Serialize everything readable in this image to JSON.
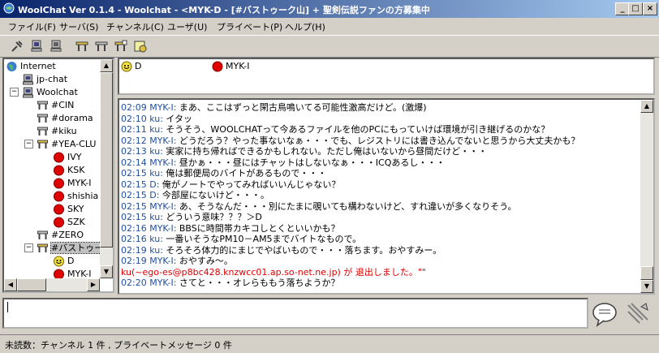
{
  "window": {
    "title": "WoolChat Ver 0.1.4 - Woolchat - <MYK-D - [#バストゥーク山] + 聖剣伝説ファンの方募集中",
    "controls": [
      "_",
      "□",
      "×"
    ]
  },
  "menu": [
    "ファイル(F)",
    "サーバ(S)",
    "チャンネル(C)",
    "ユーザ(U)",
    "プライベート(P)",
    "ヘルプ(H)"
  ],
  "tree": {
    "items": [
      {
        "label": "Internet",
        "icon": "globe-icon"
      },
      {
        "label": "jp-chat",
        "icon": "computer-icon"
      },
      {
        "label": "Woolchat",
        "icon": "computer-icon"
      },
      {
        "label": "#CIN",
        "icon": "channel-table-icon"
      },
      {
        "label": "#dorama",
        "icon": "channel-table-icon"
      },
      {
        "label": "#kiku",
        "icon": "channel-table-icon"
      },
      {
        "label": "#YEA-CLU",
        "icon": "channel-table-joined-icon"
      },
      {
        "label": "IVY",
        "icon": "user-red-icon"
      },
      {
        "label": "KSK",
        "icon": "user-red-icon"
      },
      {
        "label": "MYK-I",
        "icon": "user-red-icon"
      },
      {
        "label": "shishia",
        "icon": "user-red-icon"
      },
      {
        "label": "SKY",
        "icon": "user-red-icon"
      },
      {
        "label": "SZK",
        "icon": "user-red-icon"
      },
      {
        "label": "#ZERO",
        "icon": "channel-table-icon"
      },
      {
        "label": "#バストゥーク",
        "icon": "channel-table-joined-icon"
      },
      {
        "label": "D",
        "icon": "user-smile-icon"
      },
      {
        "label": "MYK-I",
        "icon": "user-red-icon"
      }
    ]
  },
  "users": [
    {
      "name": "D",
      "icon": "user-smile-icon"
    },
    {
      "name": "MYK-I",
      "icon": "user-red-icon"
    }
  ],
  "log": [
    {
      "time": "02:09",
      "nick": "MYK-I",
      "text": "まあ、ここはずっと閑古鳥鳴いてる可能性激高だけど。(激爆)"
    },
    {
      "time": "02:10",
      "nick": "ku",
      "text": "イタッ"
    },
    {
      "time": "02:11",
      "nick": "ku",
      "text": "そうそう、WOOLCHATって今あるファイルを他のPCにもっていけば環境が引き継げるのかな？"
    },
    {
      "time": "02:12",
      "nick": "MYK-I",
      "text": "どうだろう？やった事ないなぁ・・・でも、レジストリには書き込んでないと思うから大丈夫かも？"
    },
    {
      "time": "02:13",
      "nick": "ku",
      "text": "実家に持ち帰ればできるかもしれない。ただし俺はいないから昼間だけど・・・"
    },
    {
      "time": "02:14",
      "nick": "MYK-I",
      "text": "昼かぁ・・・昼にはチャットはしないなぁ・・・ICQあるし・・・"
    },
    {
      "time": "02:15",
      "nick": "ku",
      "text": "俺は郵便局のバイトがあるもので・・・"
    },
    {
      "time": "02:15",
      "nick": "D",
      "text": "俺がノートでやってみればいいんじゃない？"
    },
    {
      "time": "02:15",
      "nick": "D",
      "text": "今部屋にないけど・・・。"
    },
    {
      "time": "02:15",
      "nick": "MYK-I",
      "text": "あ、そうなんだ・・・別にたまに覗いても構わないけど、すれ違いが多くなりそう。"
    },
    {
      "time": "02:15",
      "nick": "ku",
      "text": "どういう意味？？？＞D"
    },
    {
      "time": "02:16",
      "nick": "MYK-I",
      "text": "BBSに時間帯カキコしとくといいかも？"
    },
    {
      "time": "02:16",
      "nick": "ku",
      "text": "一番いそうなPM10－AM5までバイトなもので。"
    },
    {
      "time": "02:19",
      "nick": "ku",
      "text": "そろそろ体力的にまじでやばいもので・・・落ちます。おやすみー。"
    },
    {
      "time": "02:19",
      "nick": "MYK-I",
      "text": "おやすみ～。"
    },
    {
      "system": "ku(~ego-es@p8bc428.knzwcc01.ap.so-net.ne.jp) が 退出しました。\"\""
    },
    {
      "time": "02:20",
      "nick": "MYK-I",
      "text": "さてと・・・オレらももう落ちようか？"
    }
  ],
  "input": {
    "value": ""
  },
  "status": "未読数：チャンネル 1 件 , プライベートメッセージ 0 件",
  "colors": {
    "title_start": "#0a246a",
    "title_end": "#a6caf0",
    "time_nick": "#2050a0",
    "system_msg": "#e00000",
    "user_icon": "#e00000"
  }
}
